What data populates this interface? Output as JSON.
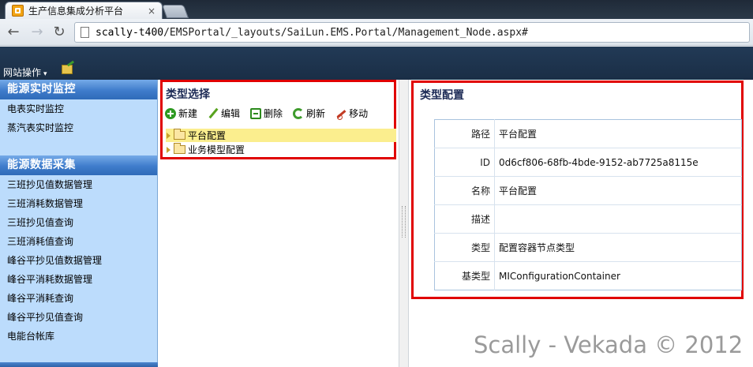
{
  "browser": {
    "tab_title": "生产信息集成分析平台",
    "close_glyph": "×",
    "back_glyph": "←",
    "forward_glyph": "→",
    "reload_glyph": "↻",
    "url_host": "scally-t400",
    "url_path": "/EMSPortal/_layouts/SaiLun.EMS.Portal/Management_Node.aspx#"
  },
  "ribbon": {
    "site_actions": "网站操作",
    "caret": "▾"
  },
  "leftnav": {
    "sections": [
      {
        "title": "能源实时监控",
        "items": [
          "电表实时监控",
          "蒸汽表实时监控"
        ]
      },
      {
        "title": "能源数据采集",
        "items": [
          "三班抄见值数据管理",
          "三班消耗数据管理",
          "三班抄见值查询",
          "三班消耗值查询",
          "峰谷平抄见值数据管理",
          "峰谷平消耗数据管理",
          "峰谷平消耗查询",
          "峰谷平抄见值查询",
          "电能台帐库"
        ]
      }
    ]
  },
  "tree": {
    "title": "类型选择",
    "toolbar": {
      "add": "新建",
      "edit": "编辑",
      "delete": "删除",
      "refresh": "刷新",
      "move": "移动"
    },
    "nodes": [
      {
        "label": "平台配置",
        "selected": true
      },
      {
        "label": "业务模型配置",
        "selected": false
      }
    ]
  },
  "properties": {
    "title": "类型配置",
    "rows": [
      {
        "key": "路径",
        "value": "平台配置"
      },
      {
        "key": "ID",
        "value": "0d6cf806-68fb-4bde-9152-ab7725a8115e"
      },
      {
        "key": "名称",
        "value": "平台配置"
      },
      {
        "key": "描述",
        "value": ""
      },
      {
        "key": "类型",
        "value": "配置容器节点类型"
      },
      {
        "key": "基类型",
        "value": "MIConfigurationContainer"
      }
    ]
  },
  "watermark": "Scally - Vekada © 2012",
  "colors": {
    "highlight_border": "#e00000",
    "nav_background": "#bcdcfc",
    "ribbon": "#1a2e46",
    "selected_node": "#fbee8e"
  }
}
